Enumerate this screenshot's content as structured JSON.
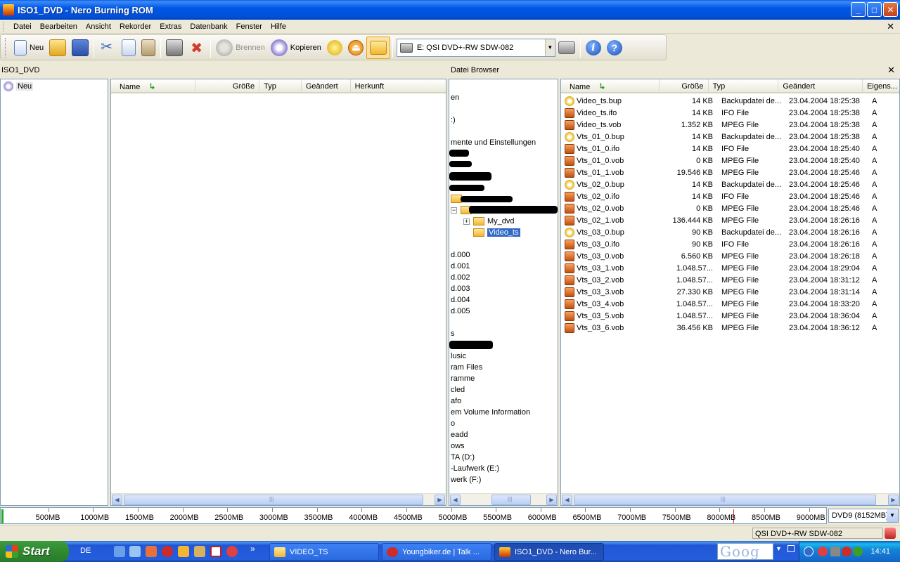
{
  "window": {
    "title": "ISO1_DVD - Nero Burning ROM",
    "buttons": {
      "minimize": "_",
      "maximize": "□",
      "close": "✕"
    }
  },
  "menubar": {
    "items": [
      "Datei",
      "Bearbeiten",
      "Ansicht",
      "Rekorder",
      "Extras",
      "Datenbank",
      "Fenster",
      "Hilfe"
    ],
    "close": "✕"
  },
  "toolbar": {
    "new_label": "Neu",
    "burn_label": "Brennen",
    "copy_label": "Kopieren",
    "drive": "E: QSI DVD+-RW SDW-082",
    "help_glyph": "i",
    "whatsthis_glyph": "?"
  },
  "compilation": {
    "header": "ISO1_DVD",
    "root_node": "Neu",
    "columns": [
      "Name",
      "Größe",
      "Typ",
      "Geändert",
      "Herkunft"
    ]
  },
  "browser": {
    "header": "Datei Browser",
    "close": "✕",
    "tree": [
      "en",
      ":)",
      "mente und Einstellungen",
      "d.000",
      "d.001",
      "d.002",
      "d.003",
      "d.004",
      "d.005",
      "s",
      "lusic",
      "ram Files",
      "ramme",
      "cled",
      "afo",
      "em Volume Information",
      "o",
      "eadd",
      "ows",
      "TA (D:)",
      "-Laufwerk (E:)",
      "werk (F:)"
    ],
    "tree_folders": {
      "expand_glyph": "+",
      "collapse_glyph": "−",
      "my_dvd": "My_dvd",
      "video_ts": "Video_ts"
    },
    "columns": [
      "Name",
      "Größe",
      "Typ",
      "Geändert",
      "Eigens..."
    ],
    "files": [
      {
        "name": "Video_ts.bup",
        "size": "14 KB",
        "type": "Backupdatei de...",
        "date": "23.04.2004 18:25:38",
        "attr": "A",
        "icon": "bup"
      },
      {
        "name": "Video_ts.ifo",
        "size": "14 KB",
        "type": "IFO File",
        "date": "23.04.2004 18:25:38",
        "attr": "A",
        "icon": "ifo"
      },
      {
        "name": "Video_ts.vob",
        "size": "1.352 KB",
        "type": "MPEG File",
        "date": "23.04.2004 18:25:38",
        "attr": "A",
        "icon": "vob"
      },
      {
        "name": "Vts_01_0.bup",
        "size": "14 KB",
        "type": "Backupdatei de...",
        "date": "23.04.2004 18:25:38",
        "attr": "A",
        "icon": "bup"
      },
      {
        "name": "Vts_01_0.ifo",
        "size": "14 KB",
        "type": "IFO File",
        "date": "23.04.2004 18:25:40",
        "attr": "A",
        "icon": "ifo"
      },
      {
        "name": "Vts_01_0.vob",
        "size": "0 KB",
        "type": "MPEG File",
        "date": "23.04.2004 18:25:40",
        "attr": "A",
        "icon": "vob"
      },
      {
        "name": "Vts_01_1.vob",
        "size": "19.546 KB",
        "type": "MPEG File",
        "date": "23.04.2004 18:25:46",
        "attr": "A",
        "icon": "vob"
      },
      {
        "name": "Vts_02_0.bup",
        "size": "14 KB",
        "type": "Backupdatei de...",
        "date": "23.04.2004 18:25:46",
        "attr": "A",
        "icon": "bup"
      },
      {
        "name": "Vts_02_0.ifo",
        "size": "14 KB",
        "type": "IFO File",
        "date": "23.04.2004 18:25:46",
        "attr": "A",
        "icon": "ifo"
      },
      {
        "name": "Vts_02_0.vob",
        "size": "0 KB",
        "type": "MPEG File",
        "date": "23.04.2004 18:25:46",
        "attr": "A",
        "icon": "vob"
      },
      {
        "name": "Vts_02_1.vob",
        "size": "136.444 KB",
        "type": "MPEG File",
        "date": "23.04.2004 18:26:16",
        "attr": "A",
        "icon": "vob"
      },
      {
        "name": "Vts_03_0.bup",
        "size": "90 KB",
        "type": "Backupdatei de...",
        "date": "23.04.2004 18:26:16",
        "attr": "A",
        "icon": "bup"
      },
      {
        "name": "Vts_03_0.ifo",
        "size": "90 KB",
        "type": "IFO File",
        "date": "23.04.2004 18:26:16",
        "attr": "A",
        "icon": "ifo"
      },
      {
        "name": "Vts_03_0.vob",
        "size": "6.560 KB",
        "type": "MPEG File",
        "date": "23.04.2004 18:26:18",
        "attr": "A",
        "icon": "vob"
      },
      {
        "name": "Vts_03_1.vob",
        "size": "1.048.57...",
        "type": "MPEG File",
        "date": "23.04.2004 18:29:04",
        "attr": "A",
        "icon": "vob"
      },
      {
        "name": "Vts_03_2.vob",
        "size": "1.048.57...",
        "type": "MPEG File",
        "date": "23.04.2004 18:31:12",
        "attr": "A",
        "icon": "vob"
      },
      {
        "name": "Vts_03_3.vob",
        "size": "27.330 KB",
        "type": "MPEG File",
        "date": "23.04.2004 18:31:14",
        "attr": "A",
        "icon": "vob"
      },
      {
        "name": "Vts_03_4.vob",
        "size": "1.048.57...",
        "type": "MPEG File",
        "date": "23.04.2004 18:33:20",
        "attr": "A",
        "icon": "vob"
      },
      {
        "name": "Vts_03_5.vob",
        "size": "1.048.57...",
        "type": "MPEG File",
        "date": "23.04.2004 18:36:04",
        "attr": "A",
        "icon": "vob"
      },
      {
        "name": "Vts_03_6.vob",
        "size": "36.456 KB",
        "type": "MPEG File",
        "date": "23.04.2004 18:36:12",
        "attr": "A",
        "icon": "vob"
      }
    ]
  },
  "scrollbar": {
    "left_arrow": "◀",
    "right_arrow": "▶",
    "grip": "|||"
  },
  "capacity": {
    "labels": [
      "500MB",
      "1000MB",
      "1500MB",
      "2000MB",
      "2500MB",
      "3000MB",
      "3500MB",
      "4000MB",
      "4500MB",
      "5000MB",
      "5500MB",
      "6000MB",
      "6500MB",
      "7000MB",
      "7500MB",
      "8000MB",
      "8500MB",
      "9000MB"
    ],
    "disc_type": "DVD9 (8152MB)",
    "used_mb": 0,
    "limit_mb": 8152
  },
  "status": {
    "drive": "QSI      DVD+-RW SDW-082"
  },
  "taskbar": {
    "start": "Start",
    "lang": "DE",
    "more": "»",
    "tasks": [
      {
        "label": "VIDEO_TS",
        "active": false
      },
      {
        "label": "Youngbiker.de | Talk ...",
        "active": false
      },
      {
        "label": "ISO1_DVD - Nero Bur...",
        "active": true
      }
    ],
    "search": "Goog",
    "clock": "14:41"
  },
  "colors": {
    "accent": "#316ac5",
    "titlebar": "#0058e6",
    "taskbar": "#245edc",
    "start": "#2f8a2f"
  }
}
